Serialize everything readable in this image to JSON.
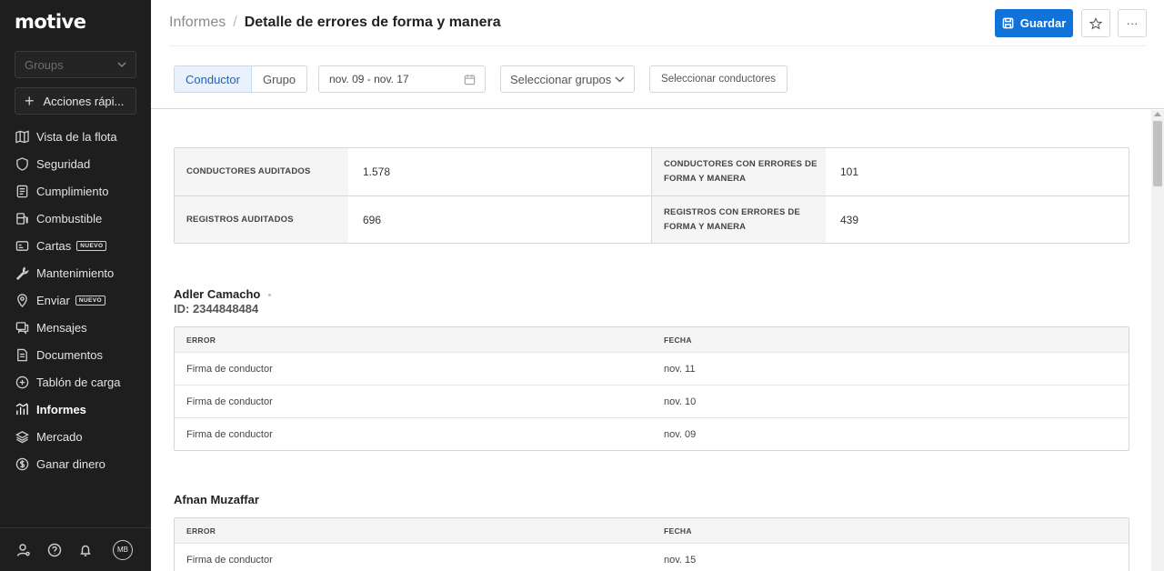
{
  "sidebar": {
    "logo": "motive",
    "groups_placeholder": "Groups",
    "quick_actions": "Acciones rápi...",
    "items": [
      {
        "label": "Vista de la flota",
        "icon": "map-icon"
      },
      {
        "label": "Seguridad",
        "icon": "shield-icon"
      },
      {
        "label": "Cumplimiento",
        "icon": "document-icon"
      },
      {
        "label": "Combustible",
        "icon": "fuel-icon"
      },
      {
        "label": "Cartas",
        "icon": "card-icon",
        "badge": "NUEVO"
      },
      {
        "label": "Mantenimiento",
        "icon": "wrench-icon"
      },
      {
        "label": "Enviar",
        "icon": "location-pin-icon",
        "badge": "NUEVO"
      },
      {
        "label": "Mensajes",
        "icon": "chat-icon"
      },
      {
        "label": "Documentos",
        "icon": "file-icon"
      },
      {
        "label": "Tablón de carga",
        "icon": "board-icon"
      },
      {
        "label": "Informes",
        "icon": "chart-icon",
        "active": true
      },
      {
        "label": "Mercado",
        "icon": "layers-icon"
      },
      {
        "label": "Ganar dinero",
        "icon": "dollar-icon"
      }
    ],
    "avatar": "MB"
  },
  "header": {
    "breadcrumb_parent": "Informes",
    "breadcrumb_sep": "/",
    "title": "Detalle de errores de forma y manera",
    "save_label": "Guardar",
    "more_label": "···",
    "toggle": {
      "driver": "Conductor",
      "group": "Grupo"
    },
    "date_range": "nov. 09 - nov. 17",
    "groups_select": "Seleccionar grupos",
    "drivers_select": "Seleccionar conductores"
  },
  "summary": {
    "drivers_audited_label": "CONDUCTORES AUDITADOS",
    "drivers_audited_value": "1.578",
    "drivers_errors_label_1": "CONDUCTORES CON ERRORES DE",
    "drivers_errors_label_2": "FORMA Y MANERA",
    "drivers_errors_value": "101",
    "logs_audited_label": "REGISTROS AUDITADOS",
    "logs_audited_value": "696",
    "logs_errors_label_1": "REGISTROS CON ERRORES DE",
    "logs_errors_label_2": "FORMA Y MANERA",
    "logs_errors_value": "439"
  },
  "drivers": [
    {
      "name": "Adler Camacho",
      "id": "ID: 2344848484",
      "col_error": "ERROR",
      "col_date": "FECHA",
      "rows": [
        {
          "error": "Firma de conductor",
          "date": "nov. 11"
        },
        {
          "error": "Firma de conductor",
          "date": "nov. 10"
        },
        {
          "error": "Firma de conductor",
          "date": "nov. 09"
        }
      ]
    },
    {
      "name": "Afnan Muzaffar",
      "col_error": "ERROR",
      "col_date": "FECHA",
      "rows": [
        {
          "error": "Firma de conductor",
          "date": "nov. 15"
        }
      ]
    }
  ]
}
